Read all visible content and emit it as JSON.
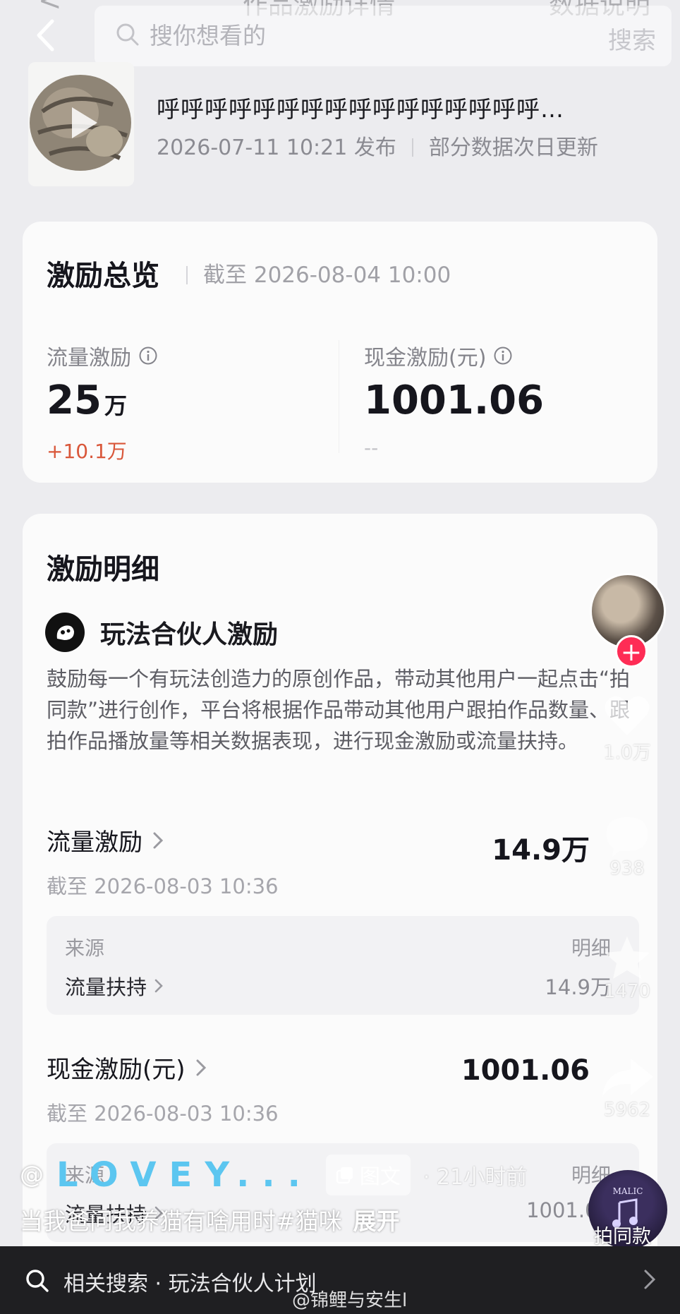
{
  "ghost_header": {
    "back": "<",
    "title": "作品激励详情",
    "right": "数据说明"
  },
  "search": {
    "placeholder": "搜你想看的",
    "button_label": "搜索"
  },
  "video": {
    "title": "呼呼呼呼呼呼呼呼呼呼呼呼呼呼呼呼…",
    "publish_time": "2026-07-11 10:21 发布",
    "update_note": "部分数据次日更新"
  },
  "overview": {
    "title": "激励总览",
    "as_of": "截至 2026-08-04 10:00",
    "traffic": {
      "label": "流量激励",
      "value": "25",
      "unit": "万",
      "change": "+10.1万"
    },
    "cash": {
      "label": "现金激励(元)",
      "value": "1001.06",
      "change": "--"
    }
  },
  "detail": {
    "title": "激励明细",
    "program_name": "玩法合伙人激励",
    "description": "鼓励每一个有玩法创造力的原创作品，带动其他用户一起点击“拍同款”进行创作，平台将根据作品带动其他用户跟拍作品数量、跟拍作品播放量等相关数据表现，进行现金激励或流量扶持。",
    "traffic_section": {
      "title": "流量激励",
      "as_of": "截至 2026-08-03 10:36",
      "value": "14.9万",
      "source_label": "来源",
      "source_value": "流量扶持",
      "detail_label": "明细",
      "detail_value": "14.9万"
    },
    "cash_section": {
      "title": "现金激励(元)",
      "as_of": "截至 2026-08-03 10:36",
      "value": "1001.06",
      "source_label": "来源",
      "source_value": "流量扶持",
      "detail_label": "明细",
      "detail_value": "1001.06"
    }
  },
  "rail": {
    "like_count": "1.0万",
    "comment_count": "938",
    "favorite_count": "1470",
    "share_count": "5962",
    "follow": "+",
    "same_style": "拍同款",
    "same_style_badge": "MALIC"
  },
  "overlay": {
    "at": "@",
    "author": "LOVEY...",
    "tag": "图文",
    "time_ago": "· 21小时前",
    "caption": "当我爸问我养猫有啥用时#猫咪",
    "expand": "展开"
  },
  "bottom_bar": {
    "text": "相关搜索 · 玩法合伙人计划",
    "watermark": "@锦鲤与安生l"
  },
  "colors": {
    "accent_red": "#fe2c55",
    "increase": "#d9573a",
    "author_blue": "#5cc6f0"
  }
}
